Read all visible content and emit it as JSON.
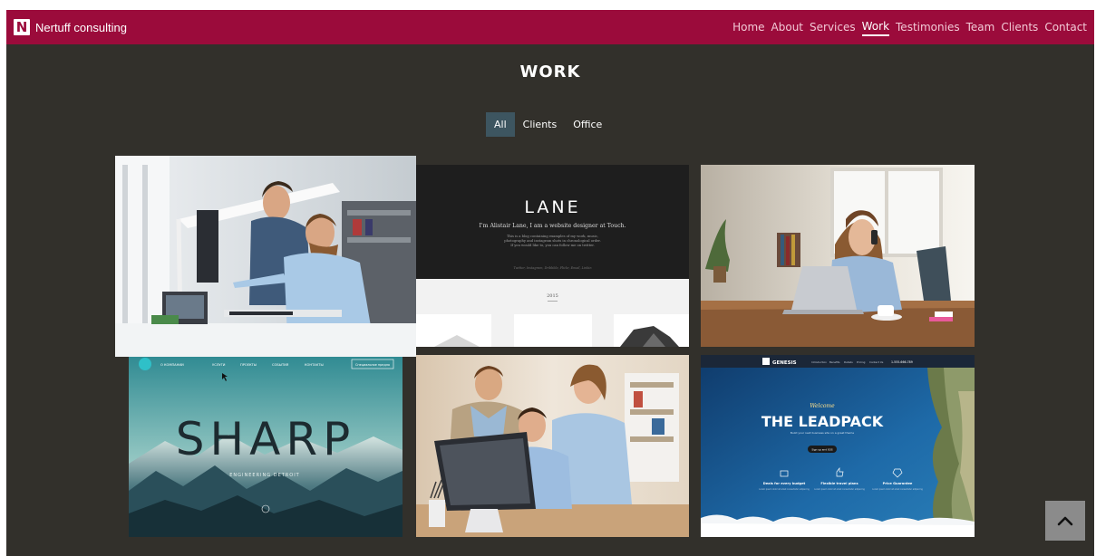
{
  "navbar": {
    "brand_logo": "N",
    "brand_name": "Nertuff consulting",
    "items": [
      {
        "label": "Home"
      },
      {
        "label": "About"
      },
      {
        "label": "Services"
      },
      {
        "label": "Work",
        "active": true
      },
      {
        "label": "Testimonies"
      },
      {
        "label": "Team"
      },
      {
        "label": "Clients"
      },
      {
        "label": "Contact"
      }
    ]
  },
  "section": {
    "title": "WORK"
  },
  "filters": [
    {
      "label": "All",
      "active": true
    },
    {
      "label": "Clients"
    },
    {
      "label": "Office"
    }
  ],
  "portfolio": {
    "lane": {
      "logo": "LANE",
      "headline": "I'm Alistair Lane, I am a website designer at Touch.",
      "line1": "This is a blog containing examples of my work, music,",
      "line2": "photography and instagram shots in chronological order.",
      "line3": "If you would like to, you can follow me on twitter.",
      "links": "Twitter, Instagram, Dribbble, Flickr, Email, Linkin",
      "year": "2015"
    },
    "sharp": {
      "logo_text": "SHARP",
      "nav": [
        "О КОМПАНИИ",
        "УСЛУГИ",
        "ПРОЕКТЫ",
        "СОБЫТИЯ",
        "КОНТАКТЫ"
      ],
      "nav_button": "Специальное предло",
      "tagline": "ENGINEERING  DETROIT"
    },
    "genesis": {
      "brand": "GENESIS",
      "nav": [
        "Introduction",
        "Benefits",
        "Details",
        "Pricing",
        "Contact Us"
      ],
      "phone": "1-555-666-789",
      "welcome": "Welcome",
      "headline": "THE LEADPACK",
      "sub": "Build your next business site on a great theme",
      "cta": "Sign up and SOS",
      "features": [
        {
          "title": "Deals for every budget",
          "text": "Lorem ipsum dolor sit amet consectetur adipiscing"
        },
        {
          "title": "Flexible travel plans",
          "text": "Lorem ipsum dolor sit amet consectetur adipiscing"
        },
        {
          "title": "Price Guarantee",
          "text": "Lorem ipsum dolor sit amet consectetur adipiscing"
        }
      ]
    }
  },
  "colors": {
    "nav_bg": "#9b0b3b",
    "page_bg": "#32302b",
    "filter_active": "#3d5560",
    "scroll_button": "#8b8b8b"
  },
  "icons": {
    "scroll_top": "chevron-up-icon",
    "genesis_feature_1": "money-icon",
    "genesis_feature_2": "thumbs-up-icon",
    "genesis_feature_3": "tag-icon"
  }
}
